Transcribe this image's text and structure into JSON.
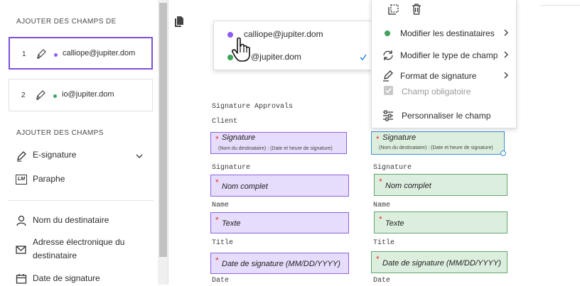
{
  "left_panel": {
    "add_fields_from_title": "AJOUTER DES CHAMPS DE",
    "recipients": [
      {
        "index": "1",
        "email": "calliope@jupiter.dom",
        "color": "#8b5cf6",
        "selected": true
      },
      {
        "index": "2",
        "email": "io@jupiter.dom",
        "color": "#3fa35c",
        "selected": false
      }
    ],
    "add_fields_title": "AJOUTER DES CHAMPS",
    "fields": {
      "esignature": "E-signature",
      "paraphe": "Paraphe",
      "paraphe_icon_text": "LM",
      "nom_destinataire": "Nom du destinataire",
      "adresse": "Adresse électronique du destinataire",
      "date_signature": "Date de signature"
    }
  },
  "recipient_dropdown": {
    "items": [
      {
        "email": "calliope@jupiter.dom",
        "color": "#8b5cf6"
      },
      {
        "email": "@jupiter.dom",
        "color": "#3fa35c",
        "checked": true
      }
    ]
  },
  "context_menu": {
    "items": {
      "modifier_destinataires": "Modifier les destinataires",
      "modifier_type": "Modifier le type de champ",
      "format_signature": "Format de signature",
      "champ_obligatoire": "Champ obligatoire",
      "personnaliser": "Personnaliser le champ"
    },
    "modifier_destinataires_dot_color": "#3fa35c"
  },
  "document": {
    "heading": "Signature Approvals",
    "col_left": {
      "label_client": "Client",
      "label_signature": "Signature",
      "label_name": "Name",
      "label_title": "Title",
      "label_date": "Date"
    },
    "col_right": {
      "label_signature": "Signature"
    },
    "fields": {
      "signature": "Signature",
      "signature_sub": "(Nom du destinataire) : (Date et heure de signature)",
      "nom_complet": "Nom complet",
      "texte": "Texte",
      "date_signature": "Date de signature (MM/DD/YYYY)"
    },
    "colors": {
      "purple": "#8b63e0",
      "green": "#5fa56a",
      "selected_blue": "#3d8fd8",
      "required": "#e3372c"
    }
  }
}
